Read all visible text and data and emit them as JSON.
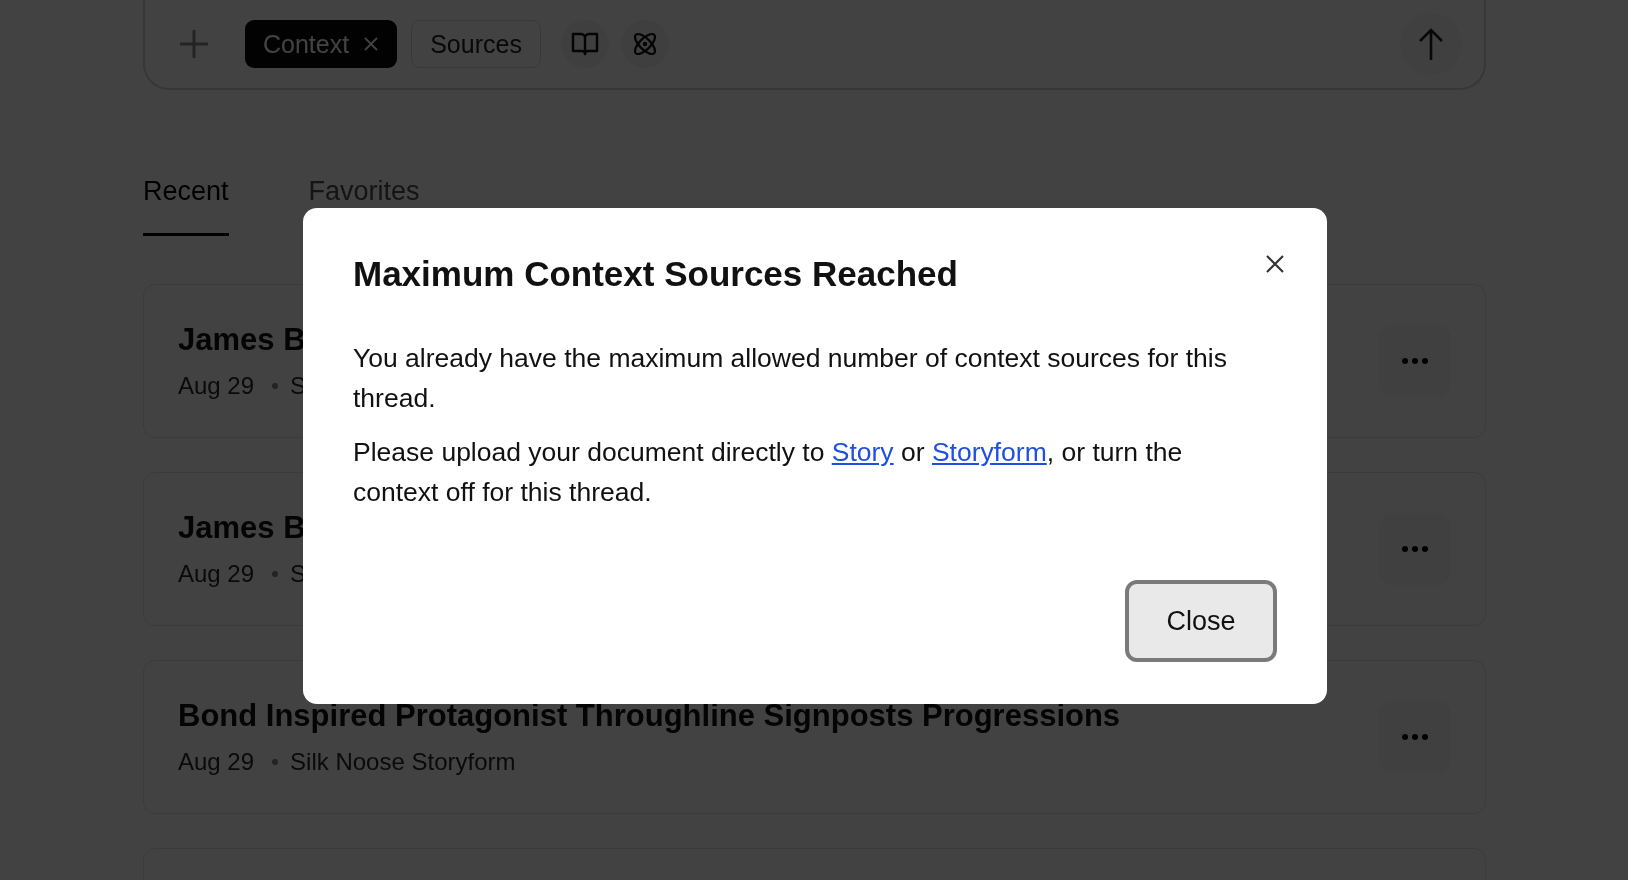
{
  "composer": {
    "chips": [
      {
        "label": "Context",
        "removable": true,
        "kind": "filled"
      },
      {
        "label": "Sources",
        "removable": false,
        "kind": "outline"
      }
    ]
  },
  "tabs": [
    {
      "label": "Recent",
      "selected": true
    },
    {
      "label": "Favorites",
      "selected": false
    }
  ],
  "threads": [
    {
      "title": "James B",
      "date": "Aug 29",
      "source": "S"
    },
    {
      "title": "James B",
      "date": "Aug 29",
      "source": "S"
    },
    {
      "title": "Bond Inspired Protagonist Throughline Signposts Progressions",
      "date": "Aug 29",
      "source": "Silk Noose Storyform"
    }
  ],
  "dialog": {
    "title": "Maximum Context Sources Reached",
    "paragraphs": [
      [
        {
          "kind": "text",
          "text": "You already have the maximum allowed number of context sources for this thread."
        }
      ],
      [
        {
          "kind": "text",
          "text": "Please upload your document directly to "
        },
        {
          "kind": "link",
          "text": "Story"
        },
        {
          "kind": "text",
          "text": " or "
        },
        {
          "kind": "link",
          "text": "Storyform"
        },
        {
          "kind": "text",
          "text": ", or turn the context off for this thread."
        }
      ]
    ],
    "close_button": {
      "label": "Close",
      "focused": true
    }
  }
}
